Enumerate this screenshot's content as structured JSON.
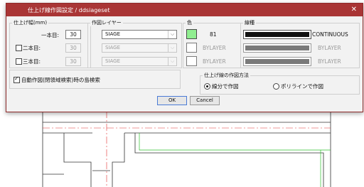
{
  "dialog": {
    "title": "仕上げ線作図設定 / ddsiageset",
    "close_glyph": "✕"
  },
  "widths": {
    "group_label": "仕上げ幅(mm)",
    "rows": [
      {
        "label": "一本目:",
        "value": "30",
        "has_checkbox": false,
        "checked": true,
        "enabled": true
      },
      {
        "label": "二本目:",
        "value": "30",
        "has_checkbox": true,
        "checked": false,
        "enabled": false
      },
      {
        "label": "三本目:",
        "value": "30",
        "has_checkbox": true,
        "checked": false,
        "enabled": false
      }
    ]
  },
  "layer": {
    "group_label": "作図レイヤー",
    "rows": [
      {
        "value": "SIAGE",
        "enabled": true
      },
      {
        "value": "SIAGE",
        "enabled": false
      },
      {
        "value": "SIAGE",
        "enabled": false
      }
    ]
  },
  "color": {
    "group_label": "色",
    "rows": [
      {
        "value": "81",
        "swatch": "#90ee90"
      },
      {
        "value": "BYLAYER",
        "swatch": "#ffffff"
      },
      {
        "value": "BYLAYER",
        "swatch": "#ffffff"
      }
    ]
  },
  "linetype": {
    "group_label": "線種",
    "rows": [
      {
        "value": "CONTINUOUS",
        "enabled": true
      },
      {
        "value": "BYLAYER",
        "enabled": false
      },
      {
        "value": "BYLAYER",
        "enabled": false
      }
    ]
  },
  "auto_search": {
    "label": "自動作図(閉領域検索)時の島検索",
    "checked": true
  },
  "method": {
    "group_label": "仕上げ線の作図方法",
    "options": [
      {
        "label": "線分で作図",
        "selected": true
      },
      {
        "label": "ポリラインで作図",
        "selected": false
      }
    ]
  },
  "buttons": {
    "ok": "OK",
    "cancel": "Cancel"
  },
  "colors": {
    "titlebar": "#a93535",
    "green_swatch": "#90ee90",
    "cad_red": "#e03030",
    "cad_green": "#30c030"
  }
}
